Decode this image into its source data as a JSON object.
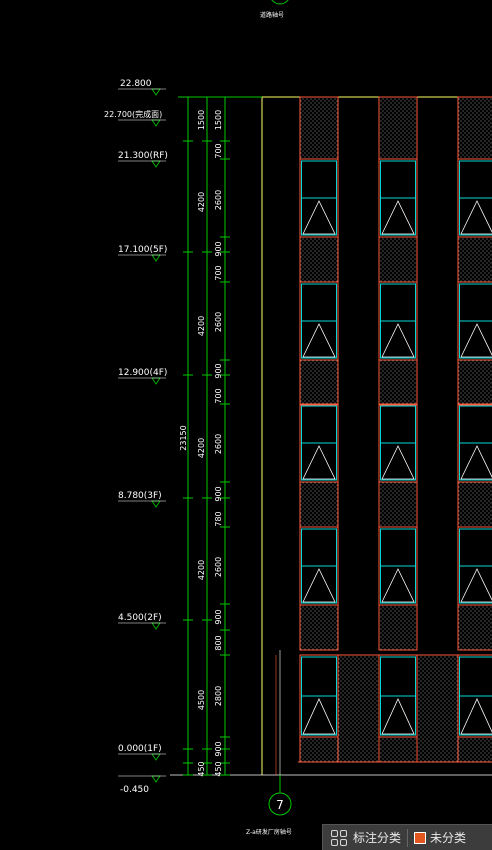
{
  "drawing": {
    "top_axis_label": "道路轴号",
    "bottom_axis_number": "7",
    "bottom_axis_label": "Z-a研发厂房轴号",
    "levels": [
      {
        "label": "22.800"
      },
      {
        "label": "22.700(完成面)"
      },
      {
        "label": "21.300(RF)"
      },
      {
        "label": "17.100(5F)"
      },
      {
        "label": "12.900(4F)"
      },
      {
        "label": "8.780(3F)"
      },
      {
        "label": "4.500(2F)"
      },
      {
        "label": "0.000(1F)"
      },
      {
        "label": "-0.450"
      }
    ],
    "total_dimension": "23150",
    "floor_dimensions": [
      "1500",
      "4200",
      "4200",
      "4200",
      "4200",
      "4500",
      "450"
    ],
    "detail_dimensions": [
      "1500",
      "700",
      "2600",
      "900",
      "700",
      "2600",
      "900",
      "700",
      "2600",
      "900",
      "780",
      "2600",
      "900",
      "800",
      "2800",
      "900",
      "450"
    ]
  },
  "toolbar": {
    "group_icon": "grid-icon",
    "annotation_category_label": "标注分类",
    "uncategorized_label": "未分类",
    "uncategorized_color": "#e2571e"
  },
  "colors": {
    "background": "#000000",
    "dimension_lines": "#00c800",
    "building_outline": "#ffff66",
    "panels": "#ff5a3c",
    "glazing": "#00d8d8",
    "text": "#ffffff"
  }
}
